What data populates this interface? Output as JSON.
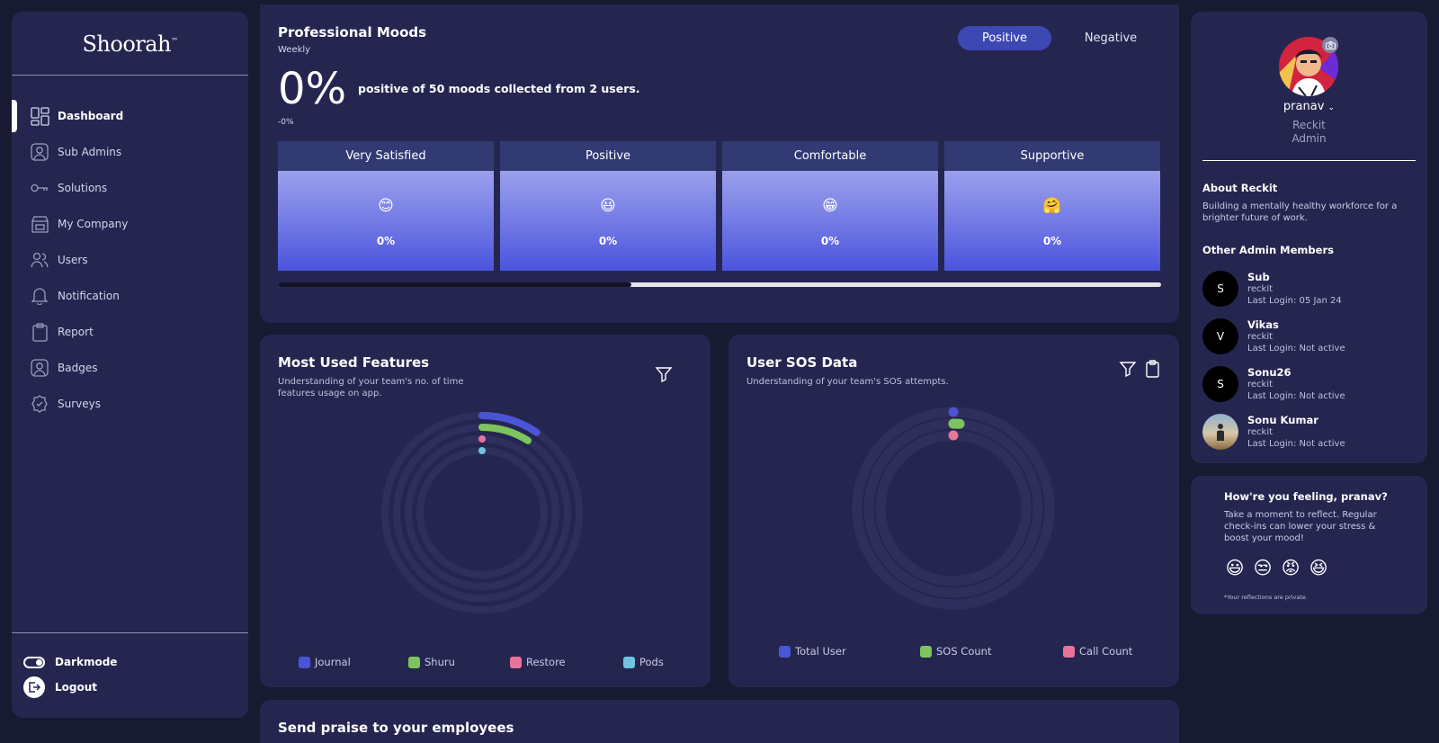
{
  "app": {
    "logo": "Shoorah",
    "logo_mark": "™"
  },
  "sidebar": {
    "items": [
      {
        "label": "Dashboard",
        "icon": "dashboard-icon",
        "active": true
      },
      {
        "label": "Sub Admins",
        "icon": "user-square-icon"
      },
      {
        "label": "Solutions",
        "icon": "key-icon"
      },
      {
        "label": "My Company",
        "icon": "store-icon"
      },
      {
        "label": "Users",
        "icon": "users-icon"
      },
      {
        "label": "Notification",
        "icon": "bell-icon"
      },
      {
        "label": "Report",
        "icon": "clipboard-icon"
      },
      {
        "label": "Badges",
        "icon": "badge-user-icon"
      },
      {
        "label": "Surveys",
        "icon": "check-badge-icon"
      }
    ],
    "darkmode_label": "Darkmode",
    "logout_label": "Logout"
  },
  "moods": {
    "title": "Professional Moods",
    "period": "Weekly",
    "toggle": {
      "positive": "Positive",
      "negative": "Negative",
      "selected": "Positive"
    },
    "big_value": "0%",
    "description": "positive of 50 moods collected from 2 users.",
    "delta": "-0%",
    "tiles": [
      {
        "label": "Very Satisfied",
        "emoji": "😊",
        "value": "0%"
      },
      {
        "label": "Positive",
        "emoji": "😃",
        "value": "0%"
      },
      {
        "label": "Comfortable",
        "emoji": "😁",
        "value": "0%"
      },
      {
        "label": "Supportive",
        "emoji": "🤗",
        "value": "0%"
      }
    ],
    "scroll_position": 0.4
  },
  "features": {
    "title": "Most Used Features",
    "description": "Understanding of your team's no. of time features usage on app.",
    "legend": [
      {
        "label": "Journal",
        "color": "#4a55d6"
      },
      {
        "label": "Shuru",
        "color": "#7dc35e"
      },
      {
        "label": "Restore",
        "color": "#e8739b"
      },
      {
        "label": "Pods",
        "color": "#6fc3df"
      }
    ],
    "arc_fractions": [
      0.095,
      0.09,
      0.0,
      0.0
    ]
  },
  "sos": {
    "title": "User SOS Data",
    "description": "Understanding of your team's SOS attempts.",
    "legend": [
      {
        "label": "Total User",
        "color": "#4a55d6"
      },
      {
        "label": "SOS Count",
        "color": "#7dc35e"
      },
      {
        "label": "Call Count",
        "color": "#e8739b"
      }
    ],
    "arc_fractions": [
      0.0,
      0.012,
      0.0
    ]
  },
  "praise": {
    "title": "Send praise to your employees"
  },
  "profile": {
    "name": "pranav",
    "org": "Reckit",
    "role": "Admin",
    "about_title": "About Reckit",
    "about_text": "Building a mentally healthy workforce for a brighter future of work.",
    "others_title": "Other Admin Members",
    "members": [
      {
        "initial": "S",
        "name": "Sub",
        "org": "reckit",
        "last_login": "Last Login: 05 Jan 24"
      },
      {
        "initial": "V",
        "name": "Vikas",
        "org": "reckit",
        "last_login": "Last Login: Not active"
      },
      {
        "initial": "S",
        "name": "Sonu26",
        "org": "reckit",
        "last_login": "Last Login: Not active"
      },
      {
        "initial": "",
        "name": "Sonu Kumar",
        "org": "reckit",
        "last_login": "Last Login: Not active"
      }
    ]
  },
  "feeling": {
    "title": "How're you feeling, pranav?",
    "text": "Take a moment to reflect. Regular check-ins can lower your stress & boost your mood!",
    "emojis": [
      "😃",
      "😒",
      "😡",
      "😆"
    ],
    "note": "*Your reflections are private"
  }
}
